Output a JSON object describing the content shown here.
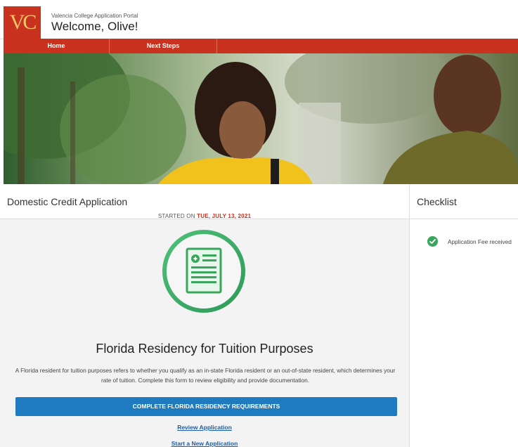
{
  "header": {
    "logo_text": "VC",
    "portal_name": "Valencia College Application Portal",
    "welcome": "Welcome, Olive!"
  },
  "nav": {
    "items": [
      {
        "label": "Home"
      },
      {
        "label": "Next Steps"
      }
    ]
  },
  "colors": {
    "brand_red": "#c8321f",
    "brand_gold": "#f5c36a",
    "action_blue": "#1e7bbf",
    "link_blue": "#1d5fa8",
    "success_green": "#3aa55d"
  },
  "application": {
    "heading": "Domestic Credit Application",
    "started_prefix": "STARTED ON",
    "started_date": "TUE, JULY 13, 2021",
    "icon": "document-icon",
    "section_title": "Florida Residency for Tuition Purposes",
    "description": "A Florida resident for tuition purposes refers to whether you qualify as an in-state Florida resident or an out-of-state resident, which determines your rate of tuition. Complete this form to review eligibility and provide documentation.",
    "cta_label": "COMPLETE FLORIDA RESIDENCY REQUIREMENTS",
    "review_link": "Review Application",
    "new_link": "Start a New Application"
  },
  "checklist": {
    "heading": "Checklist",
    "items": [
      {
        "label": "Application Fee received",
        "status": "complete",
        "icon": "check-circle-icon"
      }
    ]
  }
}
